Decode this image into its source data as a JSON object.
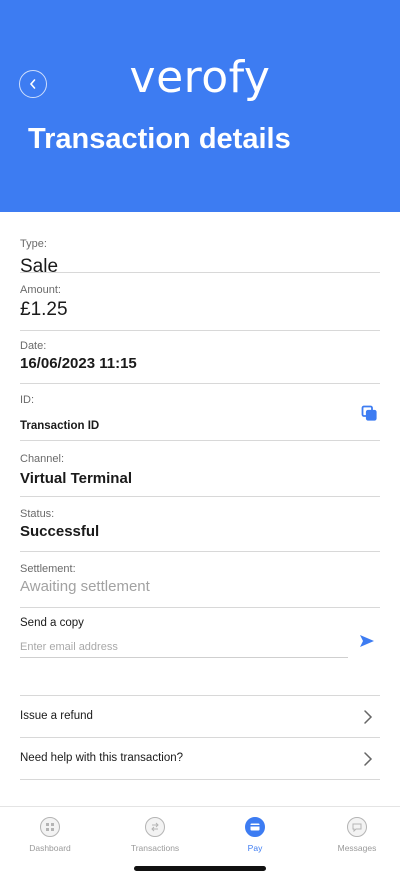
{
  "colors": {
    "brand": "#3d7cf2",
    "accent_icon": "#3d7cf2"
  },
  "header": {
    "logo_text": "verofy",
    "title": "Transaction details",
    "back_icon": "chevron-left-icon"
  },
  "details": {
    "type": {
      "label": "Type:",
      "value": "Sale"
    },
    "amount": {
      "label": "Amount:",
      "value": "£1.25"
    },
    "date": {
      "label": "Date:",
      "value": "16/06/2023 11:15"
    },
    "id": {
      "label": "ID:",
      "value": "Transaction ID",
      "copy_icon": "copy-icon"
    },
    "channel": {
      "label": "Channel:",
      "value": "Virtual Terminal"
    },
    "status": {
      "label": "Status:",
      "value": "Successful"
    },
    "settlement": {
      "label": "Settlement:",
      "value": "Awaiting settlement"
    }
  },
  "send_copy": {
    "label": "Send a copy",
    "placeholder": "Enter email address",
    "send_icon": "send-arrow-icon"
  },
  "actions": [
    {
      "label": "Issue a refund",
      "icon": "chevron-right-icon"
    },
    {
      "label": "Need help with this transaction?",
      "icon": "chevron-right-icon"
    }
  ],
  "tabbar": {
    "tabs": [
      {
        "label": "Dashboard",
        "icon": "dashboard-icon",
        "active": false
      },
      {
        "label": "Transactions",
        "icon": "transactions-icon",
        "active": false
      },
      {
        "label": "Pay",
        "icon": "pay-icon",
        "active": true
      },
      {
        "label": "Messages",
        "icon": "messages-icon",
        "active": false
      }
    ]
  }
}
